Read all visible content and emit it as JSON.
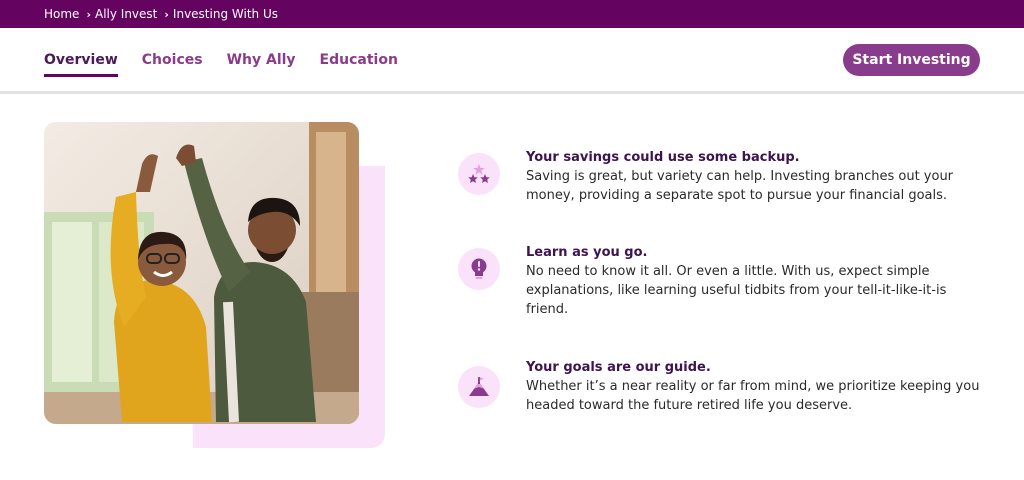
{
  "breadcrumb": {
    "items": [
      "Home",
      "Ally Invest",
      "Investing With Us"
    ]
  },
  "nav": {
    "tabs": [
      "Overview",
      "Choices",
      "Why Ally",
      "Education"
    ],
    "active_tab": "Overview",
    "cta_label": "Start Investing"
  },
  "hero_image": {
    "description_icon": "photo"
  },
  "features": [
    {
      "icon": "stars-icon",
      "title": "Your savings could use some backup.",
      "body": "Saving is great, but variety can help. Investing branches out your money, providing a separate spot to pursue your financial goals."
    },
    {
      "icon": "lightbulb-icon",
      "title": "Learn as you go.",
      "body": "No need to know it all. Or even a little. With us, expect simple explanations, like learning useful tidbits from your tell-it-like-it-is friend."
    },
    {
      "icon": "mountain-flag-icon",
      "title": "Your goals are our guide.",
      "body": "Whether it’s a near reality or far from mind, we prioritize keeping you headed toward the future retired life you deserve."
    }
  ],
  "colors": {
    "brand_purple": "#650460",
    "accent_purple": "#8a3c8c",
    "soft_pink": "#fbe2fb"
  }
}
